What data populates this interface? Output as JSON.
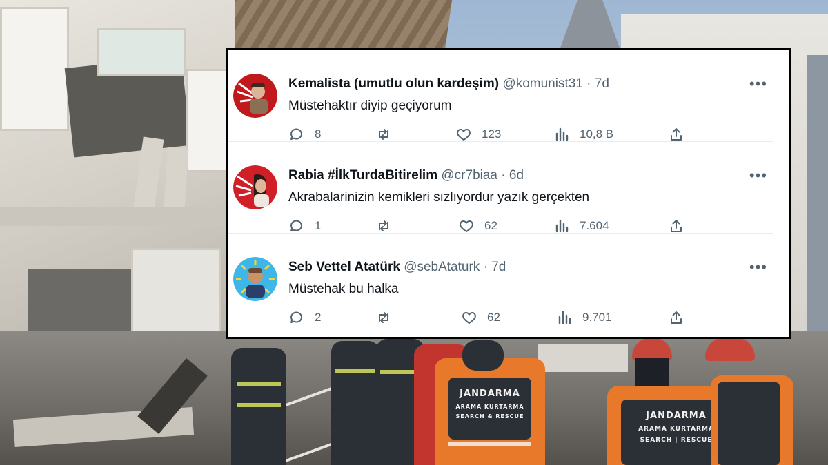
{
  "tweets": [
    {
      "name": "Kemalista (umutlu olun kardeşim)",
      "handle": "@komunist31",
      "sep": " · ",
      "time": "7d",
      "text": "Müstehaktır diyip geçiyorum",
      "replies": "8",
      "retweets": "",
      "likes": "123",
      "views": "10,8 B",
      "avatar_color": "#c0181c"
    },
    {
      "name": "Rabia #İlkTurdaBitirelim",
      "handle": "@cr7biaa",
      "sep": " · ",
      "time": "6d",
      "text": "Akrabalarinizin kemikleri sızlıyordur yazık gerçekten",
      "replies": "1",
      "retweets": "",
      "likes": "62",
      "views": "7.604",
      "avatar_color": "#d11f28"
    },
    {
      "name": "Seb Vettel Atatürk",
      "handle": "@sebAtaturk",
      "sep": " · ",
      "time": "7d",
      "text": "Müstehak bu halka",
      "replies": "2",
      "retweets": "",
      "likes": "62",
      "views": "9.701",
      "avatar_color": "#3fb6e8"
    }
  ],
  "more_label": "•••",
  "vest_labels": [
    "JANDARMA",
    "ARAMA KURTARMA",
    "SEARCH & RESCUE",
    "JANDARMA",
    "ARAMA KURTARMA",
    "SEARCH | RESCUE"
  ],
  "colors": {
    "text": "#0f1419",
    "muted": "#536471",
    "card_bg": "#ffffff",
    "vest_orange": "#e8782a"
  }
}
